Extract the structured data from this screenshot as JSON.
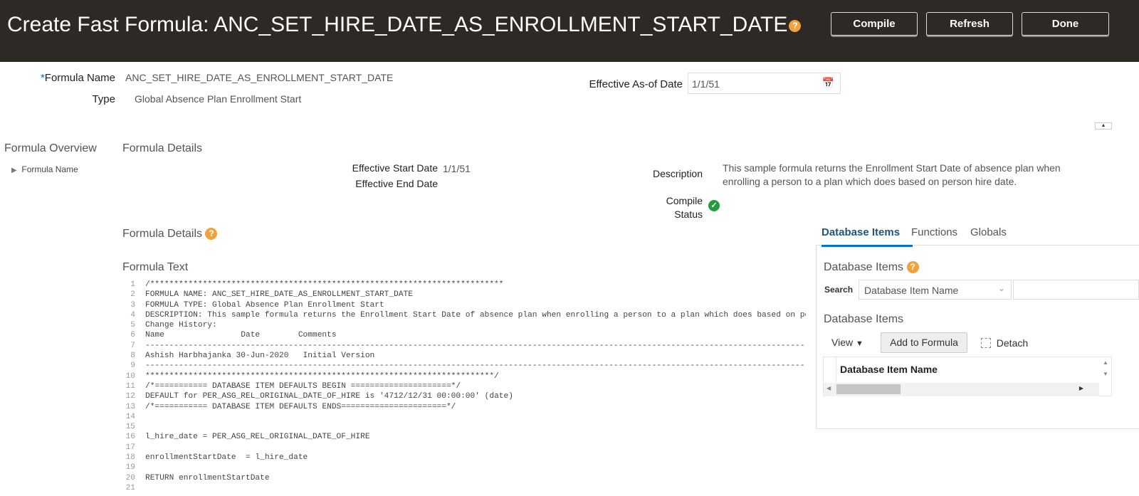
{
  "header": {
    "title": "Create Fast Formula: ANC_SET_HIRE_DATE_AS_ENROLLMENT_START_DATE",
    "help_icon": "help-icon",
    "buttons": {
      "compile": "Compile",
      "refresh": "Refresh",
      "done": "Done"
    }
  },
  "form": {
    "required_mark": "*",
    "formula_name_label": "Formula Name",
    "formula_name_value": "ANC_SET_HIRE_DATE_AS_ENROLLMENT_START_DATE",
    "type_label": "Type",
    "type_value": "Global Absence Plan Enrollment Start",
    "effective_as_of_label": "Effective As-of Date",
    "effective_as_of_value": "1/1/51"
  },
  "overview": {
    "title": "Formula Overview",
    "items": [
      {
        "label": "Formula Name"
      }
    ]
  },
  "details": {
    "title": "Formula Details",
    "start_label": "Effective Start Date",
    "start_value": "1/1/51",
    "end_label": "Effective End Date",
    "description_label": "Description",
    "description_value": "This sample formula returns the Enrollment Start Date of absence plan when enrolling a person to a plan which does based on person hire date.",
    "compile_status_label": "Compile Status",
    "compile_status": "success"
  },
  "formula": {
    "section_title": "Formula Details",
    "text_label": "Formula Text",
    "lines": [
      "/**************************************************************************",
      "FORMULA NAME: ANC_SET_HIRE_DATE_AS_ENROLLMENT_START_DATE",
      "FORMULA TYPE: Global Absence Plan Enrollment Start",
      "DESCRIPTION: This sample formula returns the Enrollment Start Date of absence plan when enrolling a person to a plan which does based on person hire date.",
      "Change History:",
      "Name                Date        Comments",
      "------------------------------------------------------------------------------------------------------------------------------------------------------",
      "Ashish Harbhajanka 30-Jun-2020   Initial Version",
      "------------------------------------------------------------------------------------------------------------------------------------------------------",
      "*************************************************************************/",
      "/*=========== DATABASE ITEM DEFAULTS BEGIN =====================*/",
      "DEFAULT for PER_ASG_REL_ORIGINAL_DATE_OF_HIRE is '4712/12/31 00:00:00' (date)",
      "/*=========== DATABASE ITEM DEFAULTS ENDS======================*/",
      "",
      "",
      "l_hire_date = PER_ASG_REL_ORIGINAL_DATE_OF_HIRE",
      "",
      "enrollmentStartDate  = l_hire_date",
      "",
      "RETURN enrollmentStartDate",
      ""
    ]
  },
  "right_panel": {
    "tabs": [
      "Database Items",
      "Functions",
      "Globals"
    ],
    "active_tab": "Database Items",
    "section_title": "Database Items",
    "search_label": "Search",
    "search_select": "Database Item Name",
    "results_title": "Database Items",
    "view_label": "View",
    "add_button": "Add to Formula",
    "detach_label": "Detach",
    "column_header": "Database Item Name"
  },
  "colors": {
    "header_bg": "#2d2925",
    "accent": "#0572ce",
    "help": "#f0a23c",
    "success": "#1f9d3a"
  }
}
